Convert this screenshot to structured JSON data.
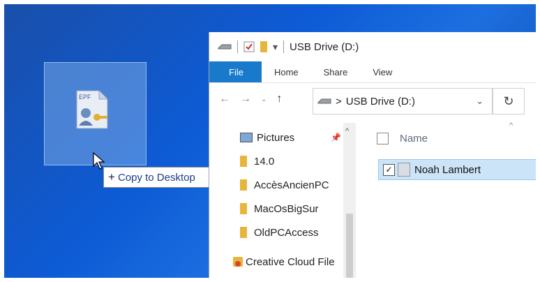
{
  "desktop": {
    "drag_tooltip": "Copy to Desktop",
    "drag_plus": "+",
    "file_icon_label": "EPF"
  },
  "window": {
    "title": "USB Drive (D:)",
    "tabs": [
      "File",
      "Home",
      "Share",
      "View"
    ],
    "address": "USB Drive (D:)",
    "address_sep": ">",
    "nav_items": [
      "Pictures",
      "14.0",
      "AccèsAncienPC",
      "MacOsBigSur",
      "OldPCAccess",
      "Creative Cloud File"
    ],
    "column_header": "Name",
    "files": [
      {
        "name": "Noah Lambert",
        "selected": true
      }
    ]
  },
  "colors": {
    "accent": "#1979ca",
    "selection": "#cce4f7",
    "desktop": "#0d5bd6"
  }
}
